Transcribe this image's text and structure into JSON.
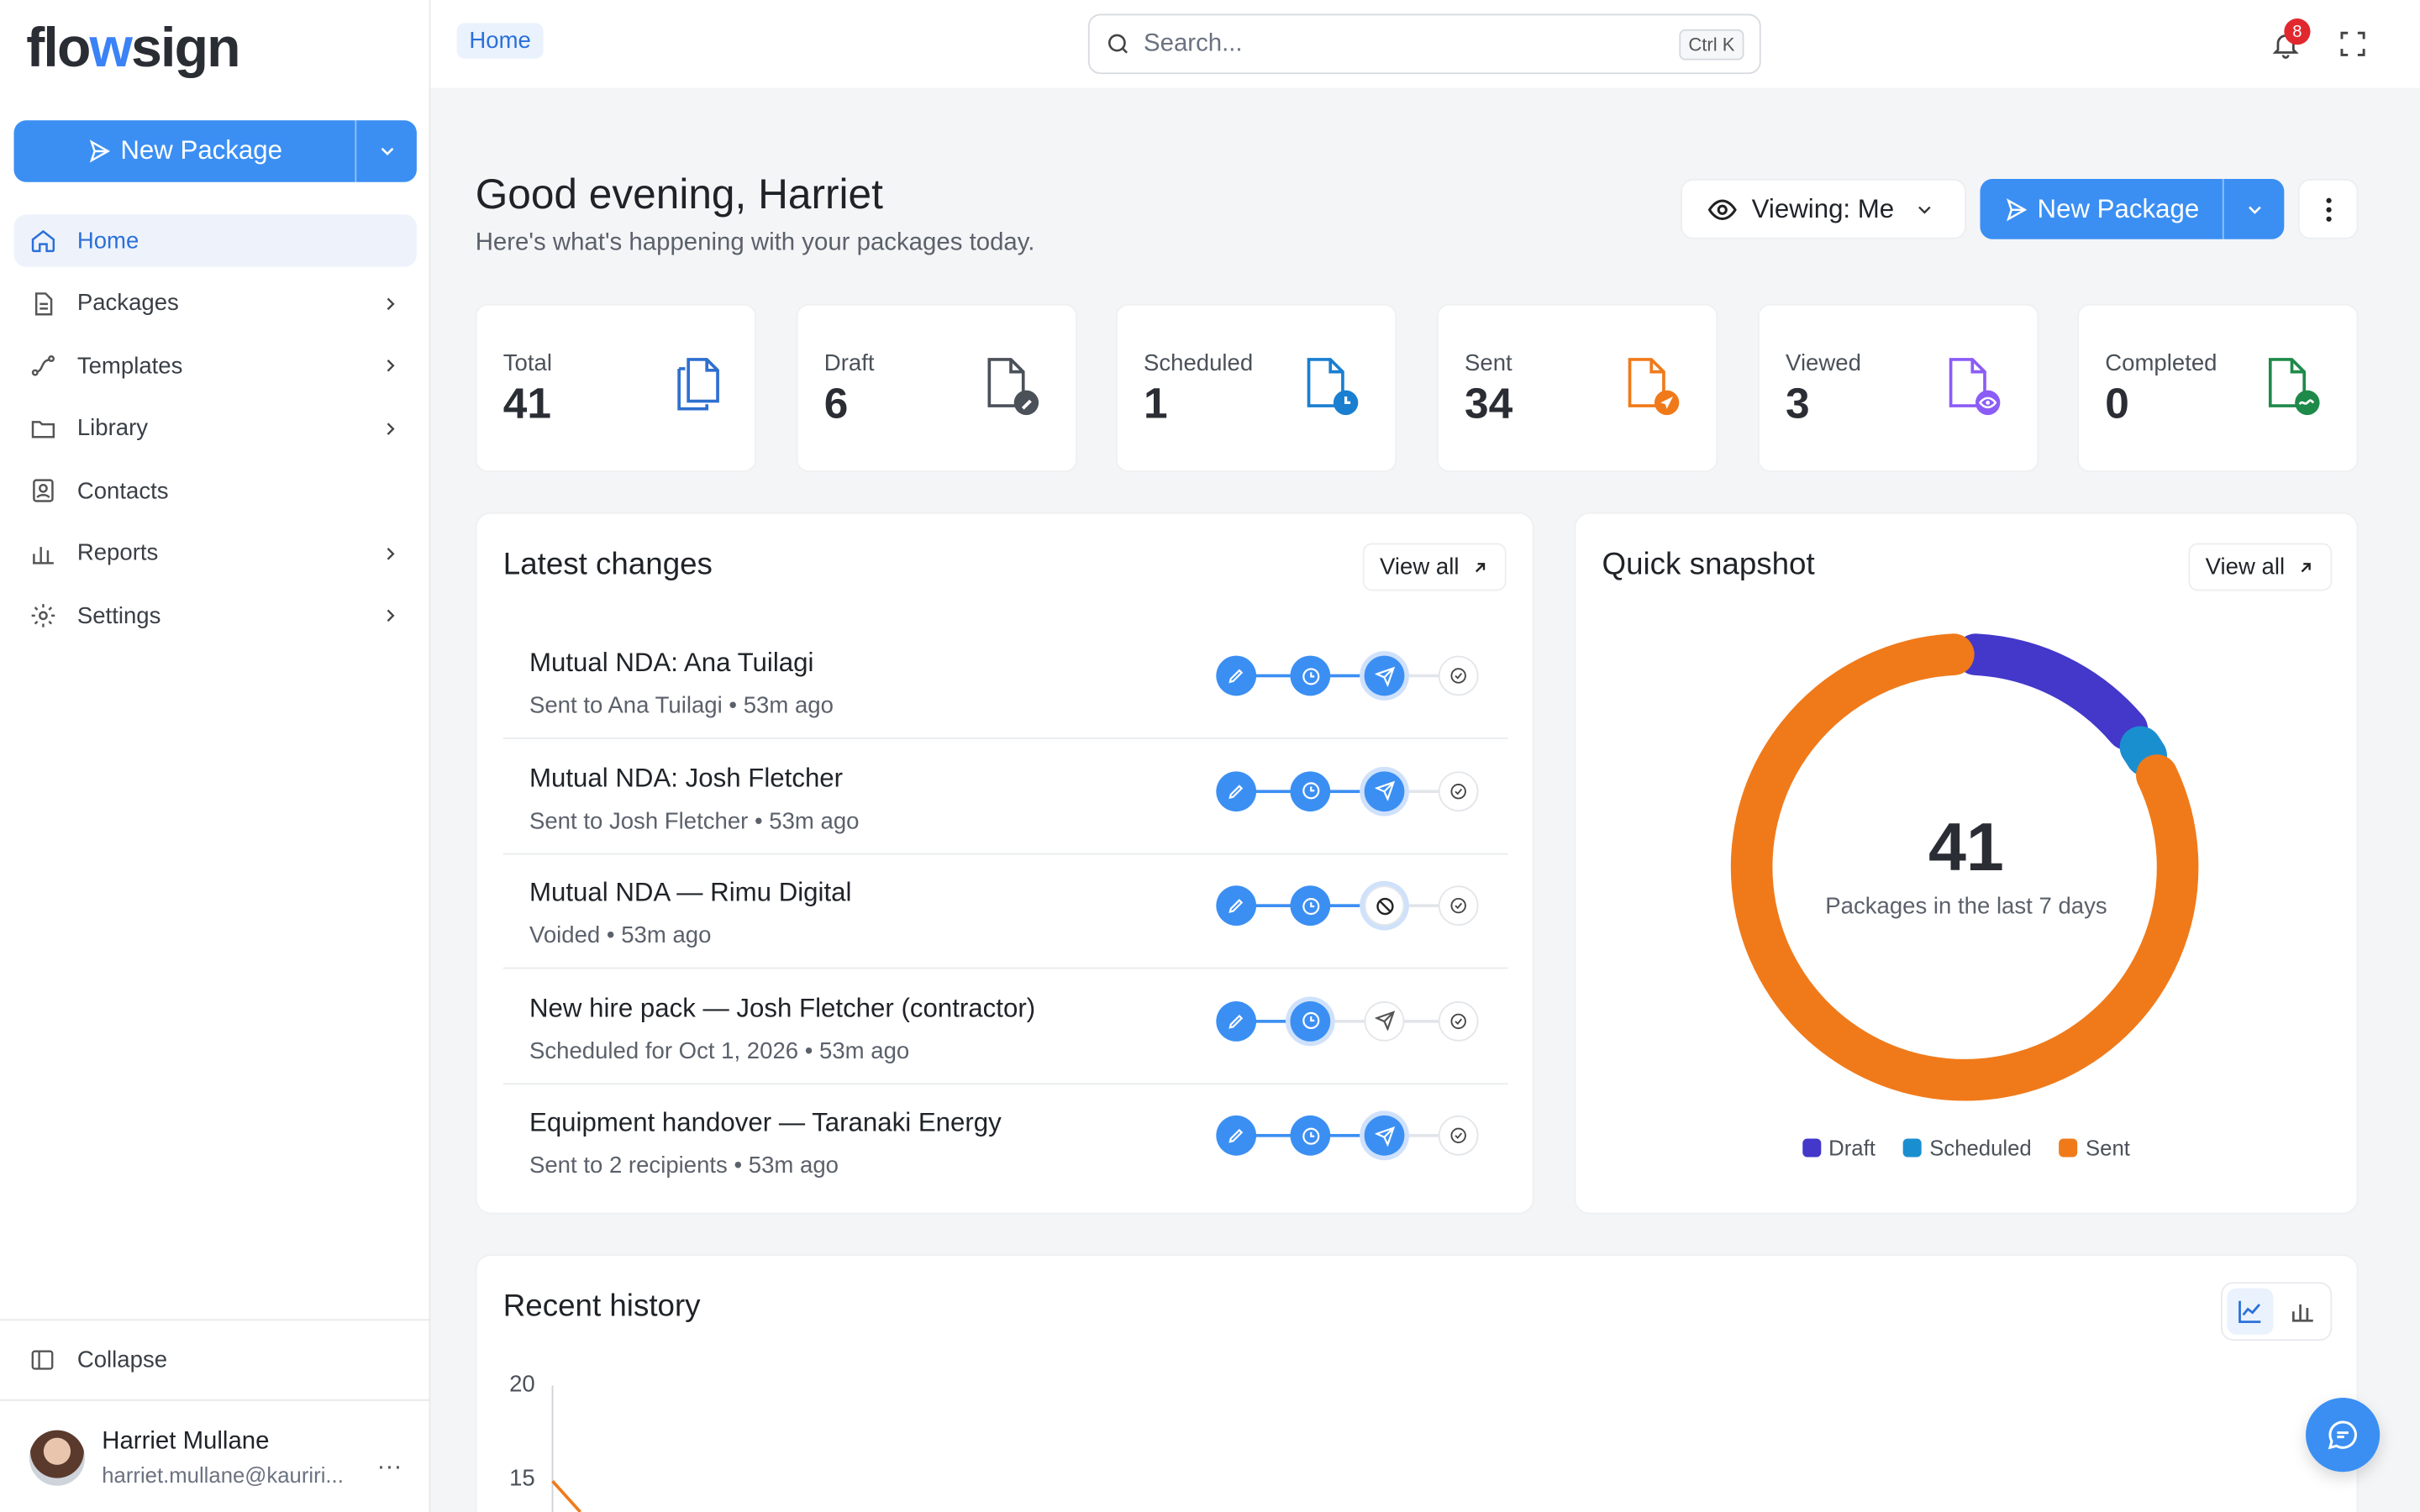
{
  "app": {
    "logo_left": "flo",
    "logo_w": "w",
    "logo_right": "sign"
  },
  "sidebar": {
    "new_package_label": "New Package",
    "items": [
      {
        "label": "Home",
        "icon": "home-icon",
        "active": true,
        "chevron": false
      },
      {
        "label": "Packages",
        "icon": "document-icon",
        "chevron": true
      },
      {
        "label": "Templates",
        "icon": "templates-icon",
        "chevron": true
      },
      {
        "label": "Library",
        "icon": "folder-icon",
        "chevron": true
      },
      {
        "label": "Contacts",
        "icon": "contacts-icon",
        "chevron": false
      },
      {
        "label": "Reports",
        "icon": "bar-chart-icon",
        "chevron": true
      },
      {
        "label": "Settings",
        "icon": "gear-icon",
        "chevron": true
      }
    ],
    "collapse_label": "Collapse",
    "user": {
      "name": "Harriet Mullane",
      "email": "harriet.mullane@kauriri...",
      "more": "..."
    }
  },
  "topbar": {
    "breadcrumb": "Home",
    "search_placeholder": "Search...",
    "search_shortcut": "Ctrl K",
    "notification_count": "8"
  },
  "header": {
    "greeting": "Good evening, Harriet",
    "subtitle": "Here's what's happening with your packages today.",
    "viewing_label": "Viewing: Me",
    "new_package_label": "New Package"
  },
  "stats": [
    {
      "label": "Total",
      "value": "41",
      "color": "#2f6fcf",
      "icon": "copy-documents-icon"
    },
    {
      "label": "Draft",
      "value": "6",
      "color": "#4b5159",
      "icon": "draft-document-icon"
    },
    {
      "label": "Scheduled",
      "value": "1",
      "color": "#1a7fd0",
      "icon": "scheduled-document-icon"
    },
    {
      "label": "Sent",
      "value": "34",
      "color": "#f07a1a",
      "icon": "sent-document-icon"
    },
    {
      "label": "Viewed",
      "value": "3",
      "color": "#8b5cf6",
      "icon": "viewed-document-icon"
    },
    {
      "label": "Completed",
      "value": "0",
      "color": "#1e8a4a",
      "icon": "completed-document-icon"
    }
  ],
  "latest_changes": {
    "title": "Latest changes",
    "view_all": "View all",
    "rows": [
      {
        "title": "Mutual NDA: Ana Tuilagi",
        "subtitle": "Sent to Ana Tuilagi • 53m ago",
        "state": "sent"
      },
      {
        "title": "Mutual NDA: Josh Fletcher",
        "subtitle": "Sent to Josh Fletcher • 53m ago",
        "state": "sent"
      },
      {
        "title": "Mutual NDA — Rimu Digital",
        "subtitle": "Voided • 53m ago",
        "state": "voided"
      },
      {
        "title": "New hire pack — Josh Fletcher (contractor)",
        "subtitle": "Scheduled for Oct 1, 2026 • 53m ago",
        "state": "scheduled"
      },
      {
        "title": "Equipment handover — Taranaki Energy",
        "subtitle": "Sent to 2 recipients • 53m ago",
        "state": "sent"
      }
    ]
  },
  "snapshot": {
    "title": "Quick snapshot",
    "view_all": "View all",
    "total": "41",
    "caption": "Packages in the last 7 days"
  },
  "chart_data": {
    "type": "pie",
    "categories": [
      "Draft",
      "Scheduled",
      "Sent"
    ],
    "values": [
      6,
      1,
      34
    ],
    "colors": [
      "#4338ca",
      "#1a8fd0",
      "#f07a1a"
    ],
    "legend": "bottom"
  },
  "recent_history": {
    "title": "Recent history",
    "y_ticks": [
      "20",
      "15"
    ]
  }
}
